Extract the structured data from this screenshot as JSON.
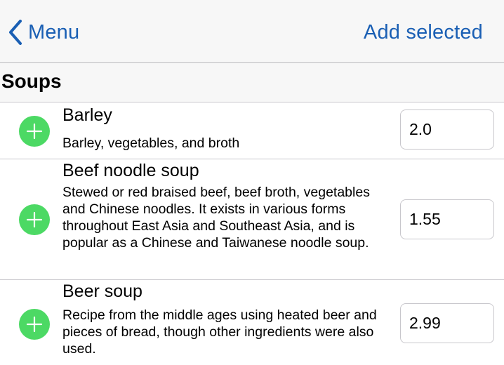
{
  "navbar": {
    "back_label": "Menu",
    "action_label": "Add selected"
  },
  "section": {
    "title": "Soups"
  },
  "items": [
    {
      "title": "Barley",
      "description": "Barley, vegetables, and broth",
      "quantity": "2.0"
    },
    {
      "title": "Beef noodle soup",
      "description": "Stewed or red braised beef, beef broth, vegetables and Chinese noodles. It exists in various forms throughout East Asia and Southeast Asia, and is popular as a Chinese and Taiwanese noodle soup.",
      "quantity": "1.55"
    },
    {
      "title": "Beer soup",
      "description": "Recipe from the middle ages using heated beer and pieces of bread, though other ingredients were also used.",
      "quantity": "2.99"
    }
  ],
  "colors": {
    "tint": "#1a5fb4",
    "add_button": "#4cd964"
  },
  "icons": {
    "back": "chevron-left-icon",
    "add": "plus-circle-icon"
  }
}
